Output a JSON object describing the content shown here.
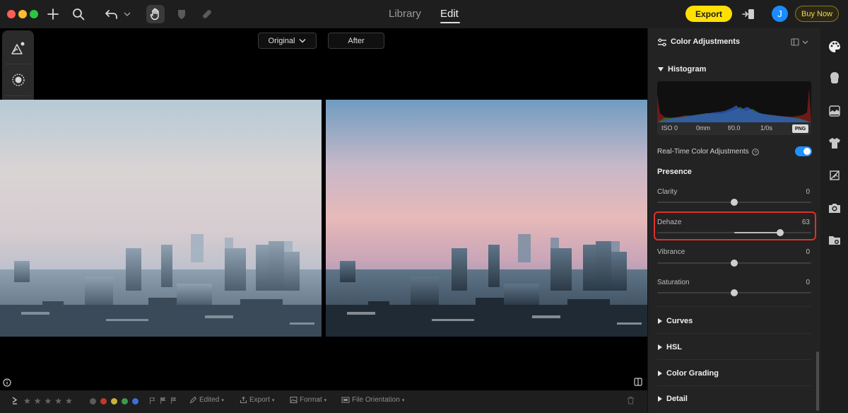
{
  "topbar": {
    "tabs": [
      {
        "label": "Library",
        "active": false
      },
      {
        "label": "Edit",
        "active": true
      }
    ],
    "export_label": "Export",
    "avatar_initial": "J",
    "buy_label": "Buy Now"
  },
  "canvas": {
    "original_label": "Original",
    "after_label": "After"
  },
  "bottombar": {
    "rating_stars": 5,
    "color_labels": [
      "#5a5a5a",
      "#c0392b",
      "#c9b23a",
      "#3c9a4a",
      "#3d6fd6"
    ],
    "edited_label": "Edited",
    "export_label": "Export",
    "format_label": "Format",
    "orientation_label": "File Orientation"
  },
  "panel": {
    "title": "Color Adjustments",
    "histogram": {
      "title": "Histogram",
      "iso": "ISO 0",
      "focal": "0mm",
      "aperture": "f/0.0",
      "shutter": "1/0s",
      "format_badge": "PNG"
    },
    "realtime_label": "Real-Time Color Adjustments",
    "realtime_enabled": true,
    "presence": {
      "title": "Presence",
      "sliders": [
        {
          "label": "Clarity",
          "value": "0",
          "fraction": 0.5,
          "fill_from": 0.5
        },
        {
          "label": "Dehaze",
          "value": "63",
          "fraction": 0.8,
          "fill_from": 0.5
        },
        {
          "label": "Vibrance",
          "value": "0",
          "fraction": 0.5,
          "fill_from": 0.5
        },
        {
          "label": "Saturation",
          "value": "0",
          "fraction": 0.5,
          "fill_from": 0.5
        }
      ]
    },
    "collapsed_sections": [
      "Curves",
      "HSL",
      "Color Grading",
      "Detail"
    ]
  },
  "colors": {
    "accent": "#1e90ff",
    "export_yellow": "#ffe000",
    "highlight_red": "#e0302a"
  }
}
